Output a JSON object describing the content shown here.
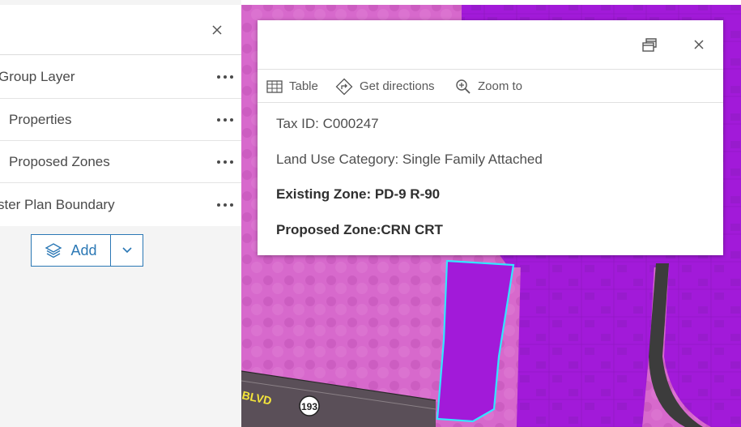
{
  "layer_panel": {
    "rows": [
      {
        "label": "Group Layer"
      },
      {
        "label": "Properties"
      },
      {
        "label": "Proposed Zones"
      },
      {
        "label": "ster Plan Boundary"
      }
    ],
    "add_label": "Add",
    "icons": {
      "close": "close-icon",
      "more": "more-options-icon",
      "add": "layers-icon",
      "dropdown": "chevron-down-icon"
    }
  },
  "map": {
    "road_label": "BLVD",
    "route_shield": "193",
    "colors": {
      "proposed_zone_pink": "#d769cc",
      "parcel_purple": "#a21ad9",
      "selection_outline": "#32e6ff"
    }
  },
  "popup": {
    "actions": [
      {
        "label": "Table",
        "icon": "table-icon"
      },
      {
        "label": "Get directions",
        "icon": "directions-icon"
      },
      {
        "label": "Zoom to",
        "icon": "zoom-to-icon"
      }
    ],
    "fields": {
      "tax_id": "Tax ID: C000247",
      "land_use": "Land Use Category: Single Family Attached",
      "existing_zone": "Existing Zone: PD-9 R-90",
      "proposed_zone": "Proposed Zone:CRN CRT"
    },
    "icons": {
      "dock": "dock-icon",
      "close": "close-icon"
    }
  }
}
